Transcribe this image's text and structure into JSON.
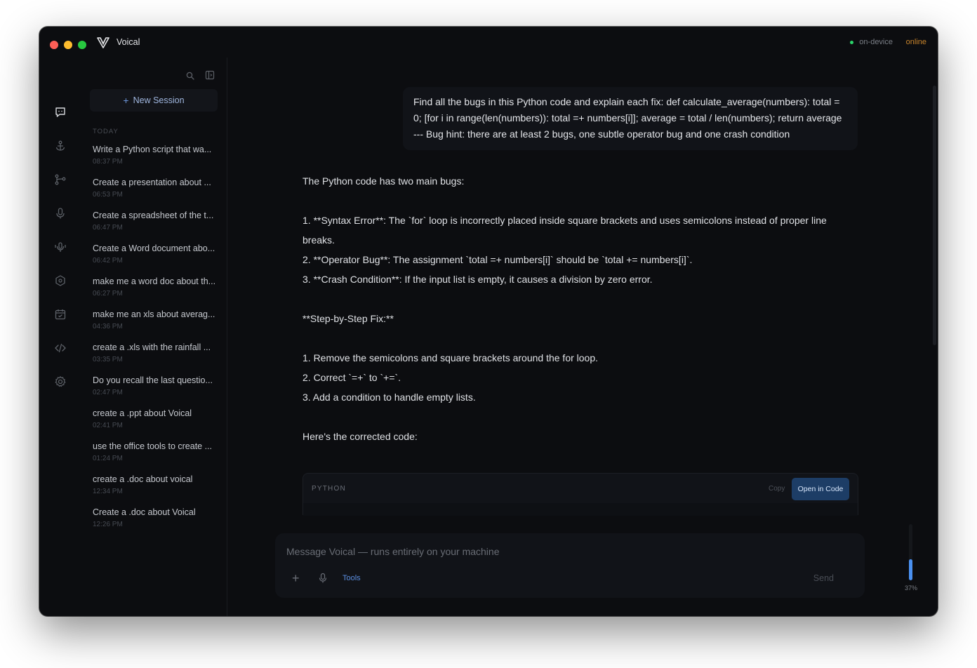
{
  "app": {
    "title": "Voical",
    "status_text": "on-device",
    "connection": "online",
    "colors": {
      "accent": "#4a90f0",
      "status_dot": "#2bd46a",
      "online": "#c9852c"
    }
  },
  "rail": {
    "icons": [
      "chat-icon",
      "anchor-icon",
      "branch-icon",
      "microphone-icon",
      "voice-icon",
      "cube-icon",
      "calendar-icon",
      "code-icon",
      "gear-icon"
    ]
  },
  "sidebar": {
    "new_session_label": "New Session",
    "section_label": "TODAY",
    "sessions": [
      {
        "title": "Write a Python script that wa...",
        "time": "08:37 PM"
      },
      {
        "title": "Create a presentation about ...",
        "time": "06:53 PM"
      },
      {
        "title": "Create a spreadsheet of the t...",
        "time": "06:47 PM"
      },
      {
        "title": "Create a Word document abo...",
        "time": "06:42 PM"
      },
      {
        "title": "make me a word doc about th...",
        "time": "06:27 PM"
      },
      {
        "title": "make me an xls about averag...",
        "time": "04:36 PM"
      },
      {
        "title": "create a .xls with the rainfall ...",
        "time": "03:35 PM"
      },
      {
        "title": "Do you recall the last questio...",
        "time": "02:47 PM"
      },
      {
        "title": "create a .ppt about Voical",
        "time": "02:41 PM"
      },
      {
        "title": "use the office tools to create ...",
        "time": "01:24 PM"
      },
      {
        "title": "create a .doc about voical",
        "time": "12:34 PM"
      },
      {
        "title": "Create a .doc about Voical",
        "time": "12:26 PM"
      }
    ]
  },
  "conversation": {
    "user_message": "Find all the bugs in this Python code and explain each fix: def calculate_average(numbers): total = 0; [for i in range(len(numbers)): total =+ numbers[i]]; average = total / len(numbers); return average --- Bug hint: there are at least 2 bugs, one subtle operator bug and one crash condition",
    "assistant_lines": [
      "The Python code has two main bugs:",
      "",
      "1. **Syntax Error**: The `for` loop is incorrectly placed inside square brackets and uses semicolons instead of proper line breaks.",
      "2. **Operator Bug**: The assignment `total =+ numbers[i]` should be `total += numbers[i]`.",
      "3. **Crash Condition**: If the input list is empty, it causes a division by zero error.",
      "",
      "**Step-by-Step Fix:**",
      "",
      "1. Remove the semicolons and square brackets around the for loop.",
      "2. Correct `=+` to `+=`.",
      "3. Add a condition to handle empty lists.",
      "",
      "Here's the corrected code:"
    ],
    "code_block": {
      "language": "PYTHON",
      "copy_label": "Copy",
      "open_label": "Open in Code"
    }
  },
  "composer": {
    "placeholder": "Message Voical — runs entirely on your machine",
    "tools_label": "Tools",
    "send_label": "Send",
    "plus_label": "+"
  },
  "usage_meter": {
    "percent": 37,
    "label": "37%"
  }
}
